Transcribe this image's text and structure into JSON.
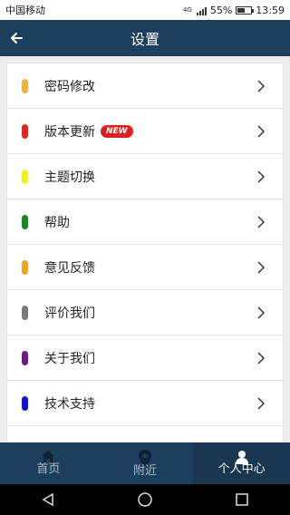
{
  "status": {
    "carrier": "中国移动",
    "network": "4G",
    "battery": "55%",
    "battery_level": 0.55,
    "time": "13:59"
  },
  "header": {
    "title": "设置",
    "back_icon": "arrow-left-icon"
  },
  "settings": [
    {
      "label": "密码修改",
      "color": "#f0b03a"
    },
    {
      "label": "版本更新",
      "color": "#e8261d",
      "badge": "NEW"
    },
    {
      "label": "主题切换",
      "color": "#f6ef1f"
    },
    {
      "label": "帮助",
      "color": "#128a21"
    },
    {
      "label": "意见反馈",
      "color": "#f3a31e"
    },
    {
      "label": "评价我们",
      "color": "#7a7a7a"
    },
    {
      "label": "关于我们",
      "color": "#6a1a8a"
    },
    {
      "label": "技术支持",
      "color": "#0d14d9"
    }
  ],
  "tabs": [
    {
      "label": "首页",
      "icon": "home-icon"
    },
    {
      "label": "附近",
      "icon": "location-pin-icon"
    },
    {
      "label": "个人中心",
      "icon": "person-icon"
    }
  ],
  "colors": {
    "primary": "#1c3f5e",
    "badge": "#e02020"
  }
}
